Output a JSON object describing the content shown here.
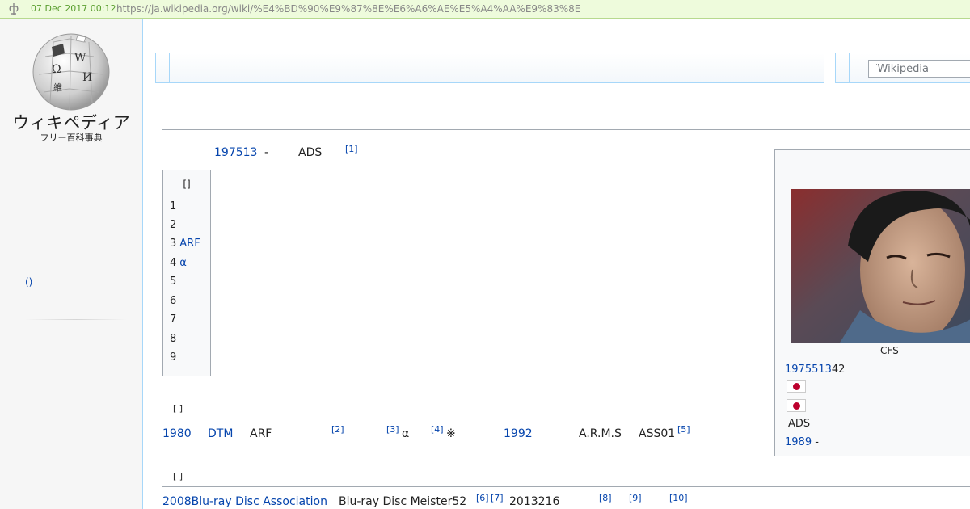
{
  "archive": {
    "date": "07 Dec 2017 00:12",
    "url": "https://ja.wikipedia.org/wiki/%E4%BD%90%E9%87%8E%E6%A6%AE%E5%A4%AA%E9%83%8E"
  },
  "sidebar": {
    "wordmark": "ウィキペディア",
    "tagline": "フリー百科事典",
    "link": "()"
  },
  "search": {
    "placeholder": "Wikipedia"
  },
  "lead": {
    "date_link": "197513",
    "dash": "-",
    "org": "ADS",
    "ref": "[1]"
  },
  "toc": {
    "title": "[]",
    "items": [
      {
        "num": "1",
        "text": ""
      },
      {
        "num": "2",
        "text": ""
      },
      {
        "num": "3",
        "text": "ARF"
      },
      {
        "num": "4",
        "text": "α"
      },
      {
        "num": "5",
        "text": ""
      },
      {
        "num": "6",
        "text": ""
      },
      {
        "num": "7",
        "text": ""
      },
      {
        "num": "8",
        "text": ""
      },
      {
        "num": "9",
        "text": ""
      }
    ]
  },
  "section1": {
    "edit": "[ ]",
    "year1980": "1980",
    "dtm": "DTM",
    "arf": "ARF",
    "ref2": "[2]",
    "ref3": "[3]",
    "alpha": "α",
    "ref4": "[4]",
    "kome": "※",
    "year1992": "1992",
    "arms": "A.R.M.S",
    "ass": "ASS01",
    "ref5": "[5]"
  },
  "section2": {
    "edit": "[ ]",
    "year_link": "2008Blu-ray Disc Association",
    "meister": "Blu-ray Disc Meister52",
    "ref6": "[6]",
    "ref7": "[7]",
    "date": "2013216",
    "ref8": "[8]",
    "ref9": "[9]",
    "ref10": "[10]"
  },
  "infobox": {
    "caption": "CFS",
    "birth_link": "1975513",
    "birth_rest": "42",
    "affiliation": "ADS",
    "year_link": "1989",
    "year_dash": "-"
  },
  "colors": {
    "link": "#0645ad",
    "archive_bar": "#eefbdc",
    "border": "#a7d7f9",
    "flag_red": "#bc002d"
  },
  "icons": [
    "archive-logo-icon",
    "wikipedia-globe-icon",
    "search-icon",
    "japan-flag-icon"
  ]
}
